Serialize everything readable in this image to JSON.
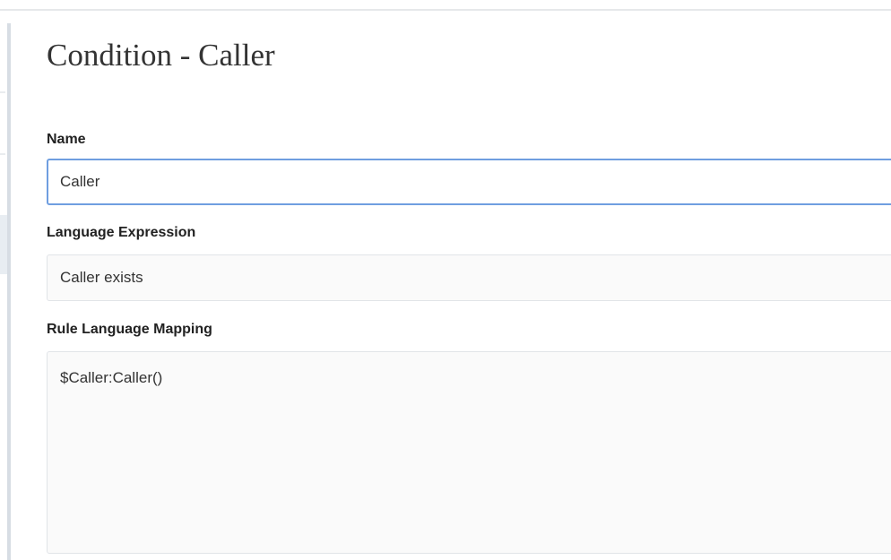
{
  "page": {
    "title": "Condition - Caller"
  },
  "form": {
    "name": {
      "label": "Name",
      "value": "Caller"
    },
    "language_expression": {
      "label": "Language Expression",
      "value": "Caller exists"
    },
    "rule_language_mapping": {
      "label": "Rule Language Mapping",
      "value": "$Caller:Caller()"
    }
  },
  "colors": {
    "focus_border": "#6f9ee0",
    "field_background": "#fafafa",
    "field_border": "#e1e4e8",
    "text": "#222222"
  }
}
